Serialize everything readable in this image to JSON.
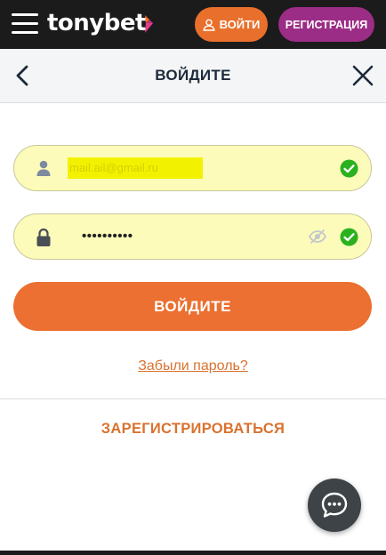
{
  "header": {
    "logo_text": "tonybet",
    "login_label": "ВОЙТИ",
    "register_label": "РЕГИСТРАЦИЯ",
    "colors": {
      "bar": "#1b1b1b",
      "login": "#e8702c",
      "register": "#9c2d86"
    }
  },
  "modal": {
    "title": "ВОЙДИТЕ",
    "email": {
      "value": "mail.ail@gmail.ru",
      "icon": "user-icon",
      "status_icon": "check-circle-icon"
    },
    "password": {
      "value": "••••••••••",
      "icon": "lock-icon",
      "toggle_icon": "eye-off-icon",
      "status_icon": "check-circle-icon"
    },
    "submit_label": "ВОЙДИТЕ",
    "forgot_label": "Забыли пароль?",
    "register_label": "ЗАРЕГИСТРИРОВАТЬСЯ",
    "colors": {
      "accent": "#eb7031",
      "field_bg": "#fcfbb9",
      "ok": "#2bb11f"
    }
  },
  "chat": {
    "icon": "chat-bubble-icon"
  }
}
